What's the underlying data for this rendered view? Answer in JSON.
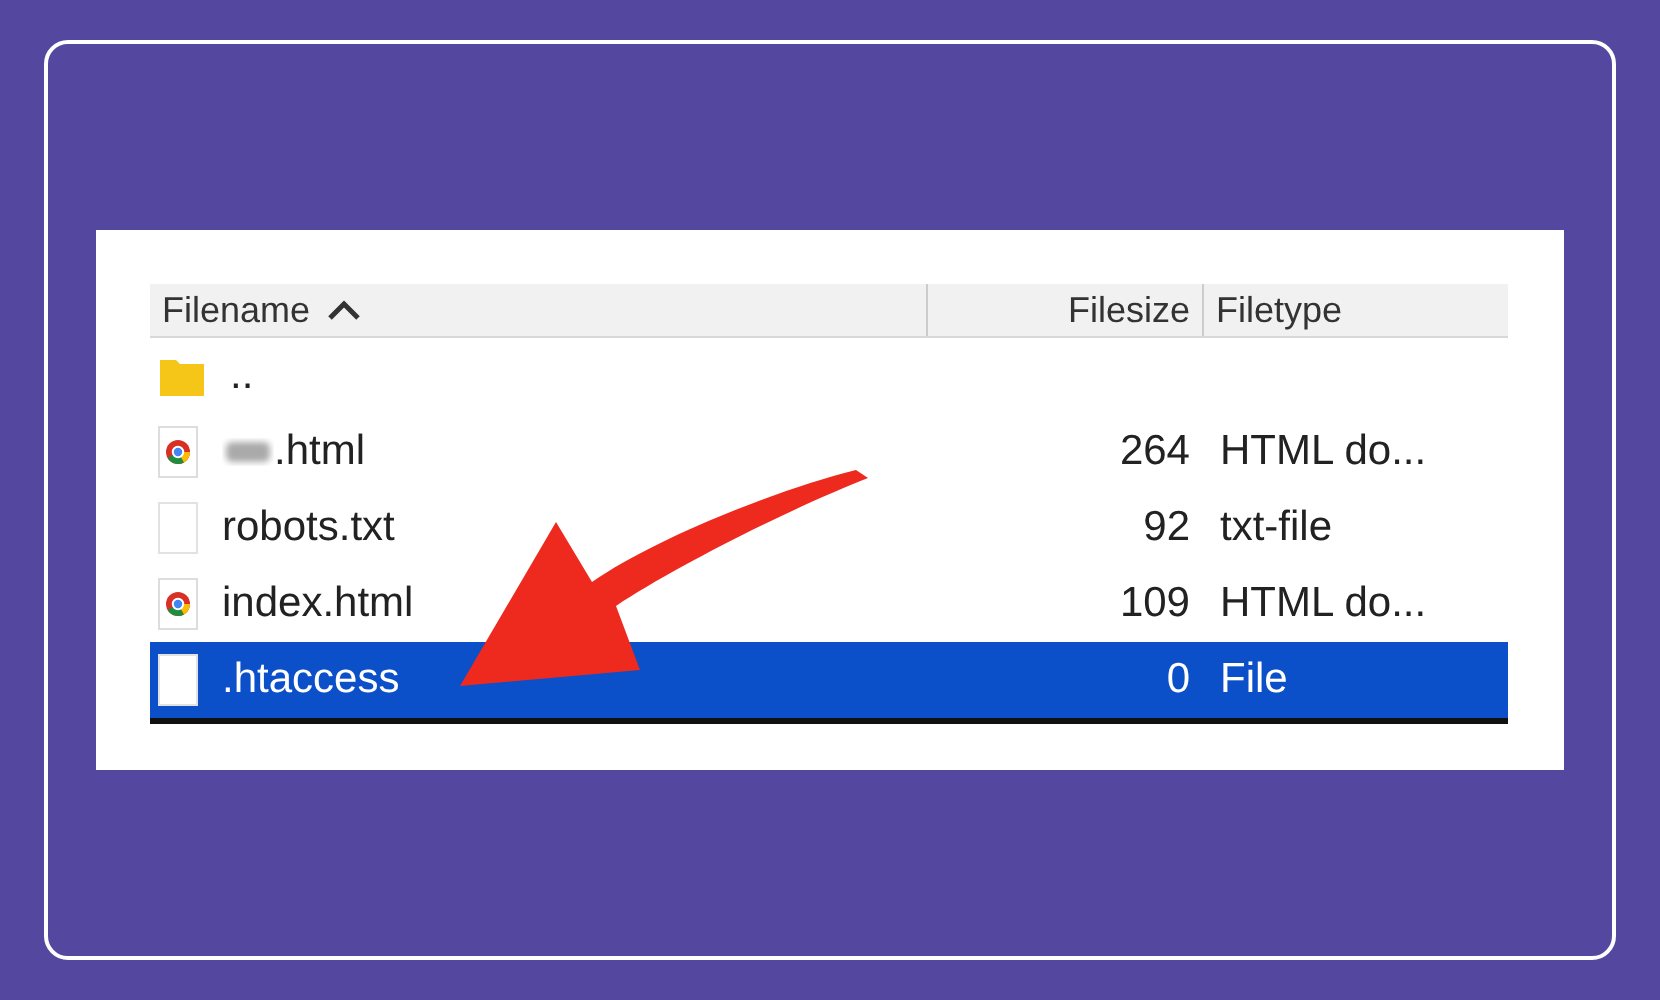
{
  "table": {
    "columns": [
      {
        "label": "Filename",
        "sorted": true
      },
      {
        "label": "Filesize"
      },
      {
        "label": "Filetype"
      }
    ],
    "rows": [
      {
        "kind": "folder",
        "name": "..",
        "selected": false
      },
      {
        "kind": "web",
        "name": ".html",
        "blurred_prefix": true,
        "size": "264",
        "type": "HTML do...",
        "selected": false
      },
      {
        "kind": "blank",
        "name": "robots.txt",
        "size": "92",
        "type": "txt-file",
        "selected": false
      },
      {
        "kind": "web",
        "name": "index.html",
        "size": "109",
        "type": "HTML do...",
        "selected": false
      },
      {
        "kind": "blank",
        "name": ".htaccess",
        "size": "0",
        "type": "File",
        "selected": true
      }
    ]
  }
}
